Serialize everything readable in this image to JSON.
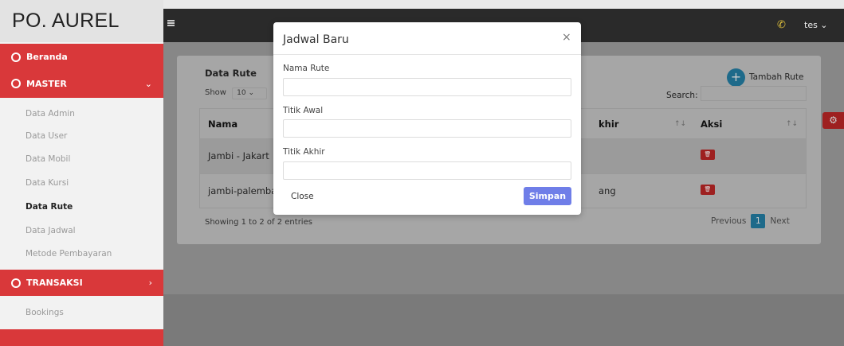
{
  "brand": "PO. AUREL",
  "sidebar": {
    "beranda": "Beranda",
    "master": {
      "label": "MASTER",
      "chevron": "⌄"
    },
    "master_items": [
      "Data Admin",
      "Data User",
      "Data Mobil",
      "Data Kursi",
      "Data Rute",
      "Data Jadwal",
      "Metode Pembayaran"
    ],
    "active_item": "Data Rute",
    "transaksi": {
      "label": "TRANSAKSI",
      "chevron": "›"
    },
    "transaksi_items": [
      "Bookings"
    ]
  },
  "topbar": {
    "menu_icon": "hamburger-icon",
    "phone_icon": "phone-icon",
    "user": "tes ⌄"
  },
  "card": {
    "title": "Data Rute",
    "show_label": "Show",
    "show_value": "10",
    "add_button": "Tambah Rute",
    "search_label": "Search:",
    "columns": [
      "Nama",
      "khir",
      "Aksi"
    ],
    "rows": [
      {
        "nama": "Jambi - Jakart",
        "akhir": ""
      },
      {
        "nama": "jambi-palemba",
        "akhir": "ang"
      }
    ],
    "showing": "Showing 1 to 2 of 2 entries",
    "pager": {
      "previous": "Previous",
      "current": "1",
      "next": "Next"
    }
  },
  "modal": {
    "title": "Jadwal Baru",
    "close_icon": "×",
    "fields": [
      {
        "label": "Nama Rute",
        "value": ""
      },
      {
        "label": "Titik Awal",
        "value": ""
      },
      {
        "label": "Titik Akhir",
        "value": ""
      }
    ],
    "close_button": "Close",
    "save_button": "Simpan"
  },
  "colors": {
    "accent_red": "#d9383a",
    "primary": "#6f7ee8",
    "topbar": "#2a2a2a"
  }
}
